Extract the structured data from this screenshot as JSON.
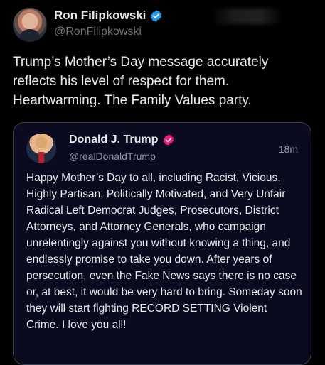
{
  "author": {
    "name": "Ron Filipkowski",
    "handle": "@RonFilipkowski",
    "verified_badge_color": "#1d9bf0"
  },
  "tweet": {
    "text": "Trump’s Mother’s Day message accurately reflects his level of respect for them. Heartwarming. The Family Values party."
  },
  "quoted": {
    "name": "Donald J. Trump",
    "handle": "@realDonaldTrump",
    "time": "18m",
    "badge_color": "#f91880",
    "text": "Happy Mother’s Day to all, including Racist, Vicious, Highly Partisan, Politically Motivated, and Very Unfair Radical Left Democrat Judges, Prosecutors, District Attorneys, and Attorney Generals, who campaign unrelentingly against you without knowing a thing, and endlessly promise to take you down. After years of persecution, even the Fake News says there is no case or, at best, it would be very hard to bring. Someday soon they will start fighting RECORD SETTING Violent Crime. I love you all!"
  },
  "colors": {
    "background": "#000000",
    "quote_background": "#0b0b20",
    "text_primary": "#e7e9ea",
    "text_secondary": "#71767b"
  }
}
